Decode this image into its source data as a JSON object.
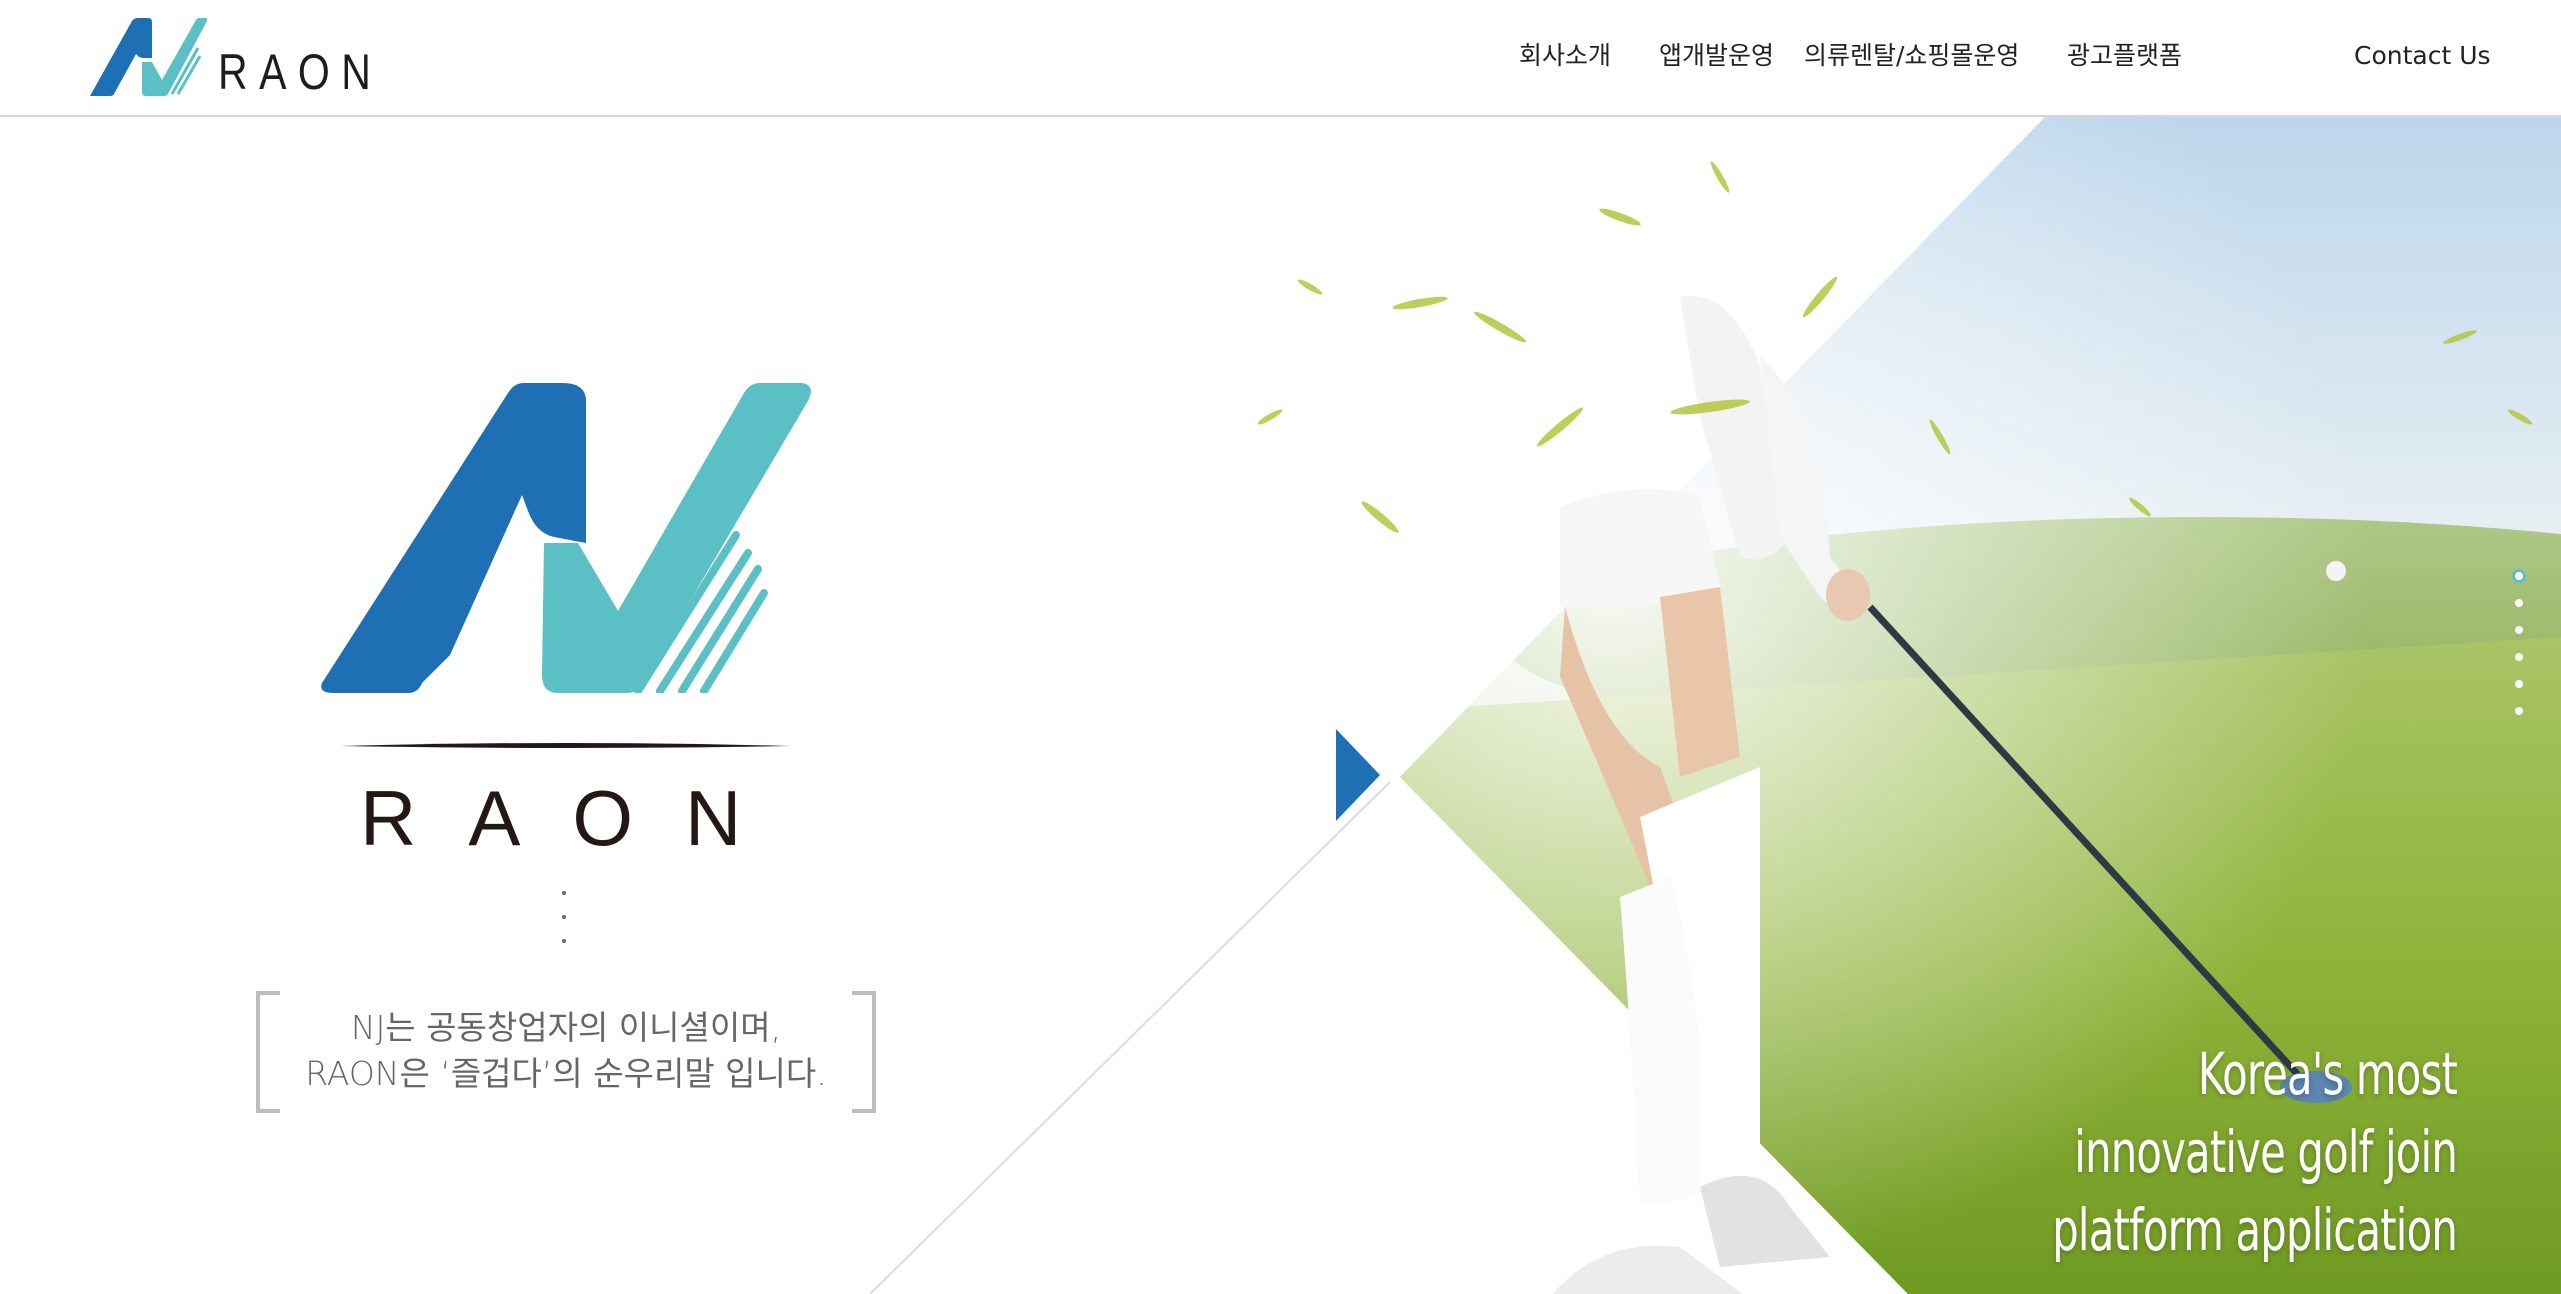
{
  "header": {
    "brand_name": "RAON",
    "nav": [
      {
        "label": "회사소개"
      },
      {
        "label": "앱개발운영"
      },
      {
        "label": "의류렌탈/쇼핑몰운영"
      },
      {
        "label": "광고플랫폼"
      },
      {
        "label": "Contact Us"
      }
    ]
  },
  "hero": {
    "wordmark": "RAON",
    "tagline_line1": "NJ는 공동창업자의 이니셜이며,",
    "tagline_line2": "RAON은 ‘즐겁다’의 순우리말 입니다.",
    "caption_line1": "Korea's most",
    "caption_line2": "innovative  golf join",
    "caption_line3": "platform  application",
    "slides_count": 6,
    "active_slide": 1
  },
  "colors": {
    "brand_blue": "#1e6fb3",
    "brand_teal": "#5bbfc6",
    "text_dark": "#231815",
    "grass": "#8fb33a"
  },
  "icons": {
    "logo": "raon-nv-logo-icon",
    "arrow": "play-triangle-icon"
  }
}
